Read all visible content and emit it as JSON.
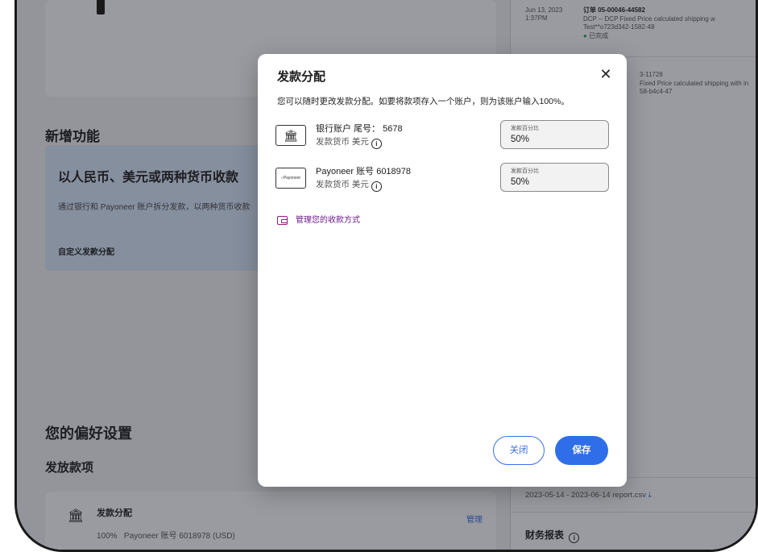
{
  "background": {
    "new_features_title": "新增功能",
    "promo": {
      "title": "以人民币、美元或两种货币收款",
      "desc": "通过银行和 Payoneer 账户拆分发款，以两种货币收款",
      "link": "自定义发款分配"
    },
    "prefs_title": "您的偏好设置",
    "payments_title": "发放款项",
    "allocation_row": {
      "title": "发款分配",
      "detail": "100%   Payoneer 账号 6018978 (USD)",
      "manage": "管理"
    },
    "activity": {
      "date": "Jun 13, 2023",
      "time": "1:37PM",
      "order": "订单 05-00046-44582",
      "desc1": "DCP -- DCP Fixed Price calculated shipping w",
      "desc2": "Test**o723d342-1582-48",
      "status": "已完成",
      "order2": "3-11728",
      "desc3": "Fixed Price calculated shipping with in",
      "desc4": "58-b4c4-47"
    },
    "report_link": "2023-05-14 - 2023-06-14 report.csv",
    "finance_title": "财务报表"
  },
  "modal": {
    "title": "发款分配",
    "description": "您可以随时更改发款分配。如要将款项存入一个账户，则为该账户输入100%。",
    "accounts": [
      {
        "name": "银行账户 尾号： 5678",
        "currency": "发款货币 美元",
        "percent_label": "发款百分比",
        "percent_value": "50%"
      },
      {
        "name": "Payoneer 账号 6018978",
        "currency": "发款货币 美元",
        "percent_label": "发款百分比",
        "percent_value": "50%",
        "logo_text": "Payoneer"
      }
    ],
    "manage_link": "管理您的收款方式",
    "close_label": "关闭",
    "save_label": "保存"
  },
  "colors": {
    "accent": "#2f6ee8",
    "link_purple": "#6a1b8a",
    "promo_bg": "#dbe9fb",
    "status_green": "#2e9e4f"
  }
}
